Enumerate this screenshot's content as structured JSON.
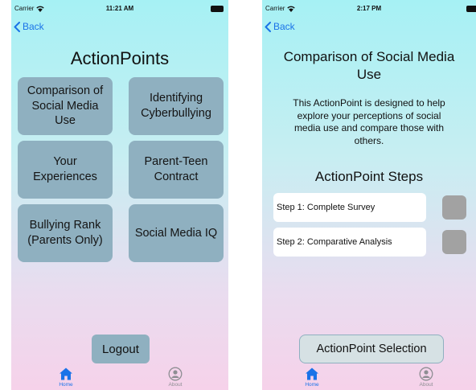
{
  "left_screen": {
    "status": {
      "carrier": "Carrier",
      "time": "11:21 AM"
    },
    "back_label": "Back",
    "title": "ActionPoints",
    "buttons": [
      {
        "label": "Comparison of Social Media Use"
      },
      {
        "label": "Identifying Cyberbullying"
      },
      {
        "label": "Your Experiences"
      },
      {
        "label": "Parent-Teen Contract"
      },
      {
        "label": "Bullying Rank (Parents Only)"
      },
      {
        "label": "Social Media IQ"
      }
    ],
    "logout_label": "Logout",
    "tabs": [
      {
        "label": "Home",
        "icon": "house-icon",
        "active": true
      },
      {
        "label": "About",
        "icon": "person-circle-icon",
        "active": false
      }
    ]
  },
  "right_screen": {
    "status": {
      "carrier": "Carrier",
      "time": "2:17 PM"
    },
    "back_label": "Back",
    "title": "Comparison of Social Media Use",
    "description": "This ActionPoint is designed to help explore your perceptions of social media use and compare those with others.",
    "steps_heading": "ActionPoint Steps",
    "steps": [
      {
        "label": "Step 1: Complete Survey"
      },
      {
        "label": "Step 2: Comparative Analysis"
      }
    ],
    "selection_label": "ActionPoint Selection",
    "tabs": [
      {
        "label": "Home",
        "icon": "house-icon",
        "active": true
      },
      {
        "label": "About",
        "icon": "person-circle-icon",
        "active": false
      }
    ]
  },
  "colors": {
    "accent": "#1a73e8",
    "button_bg": "#8fb0c0",
    "check_box": "#a2a2a2"
  }
}
